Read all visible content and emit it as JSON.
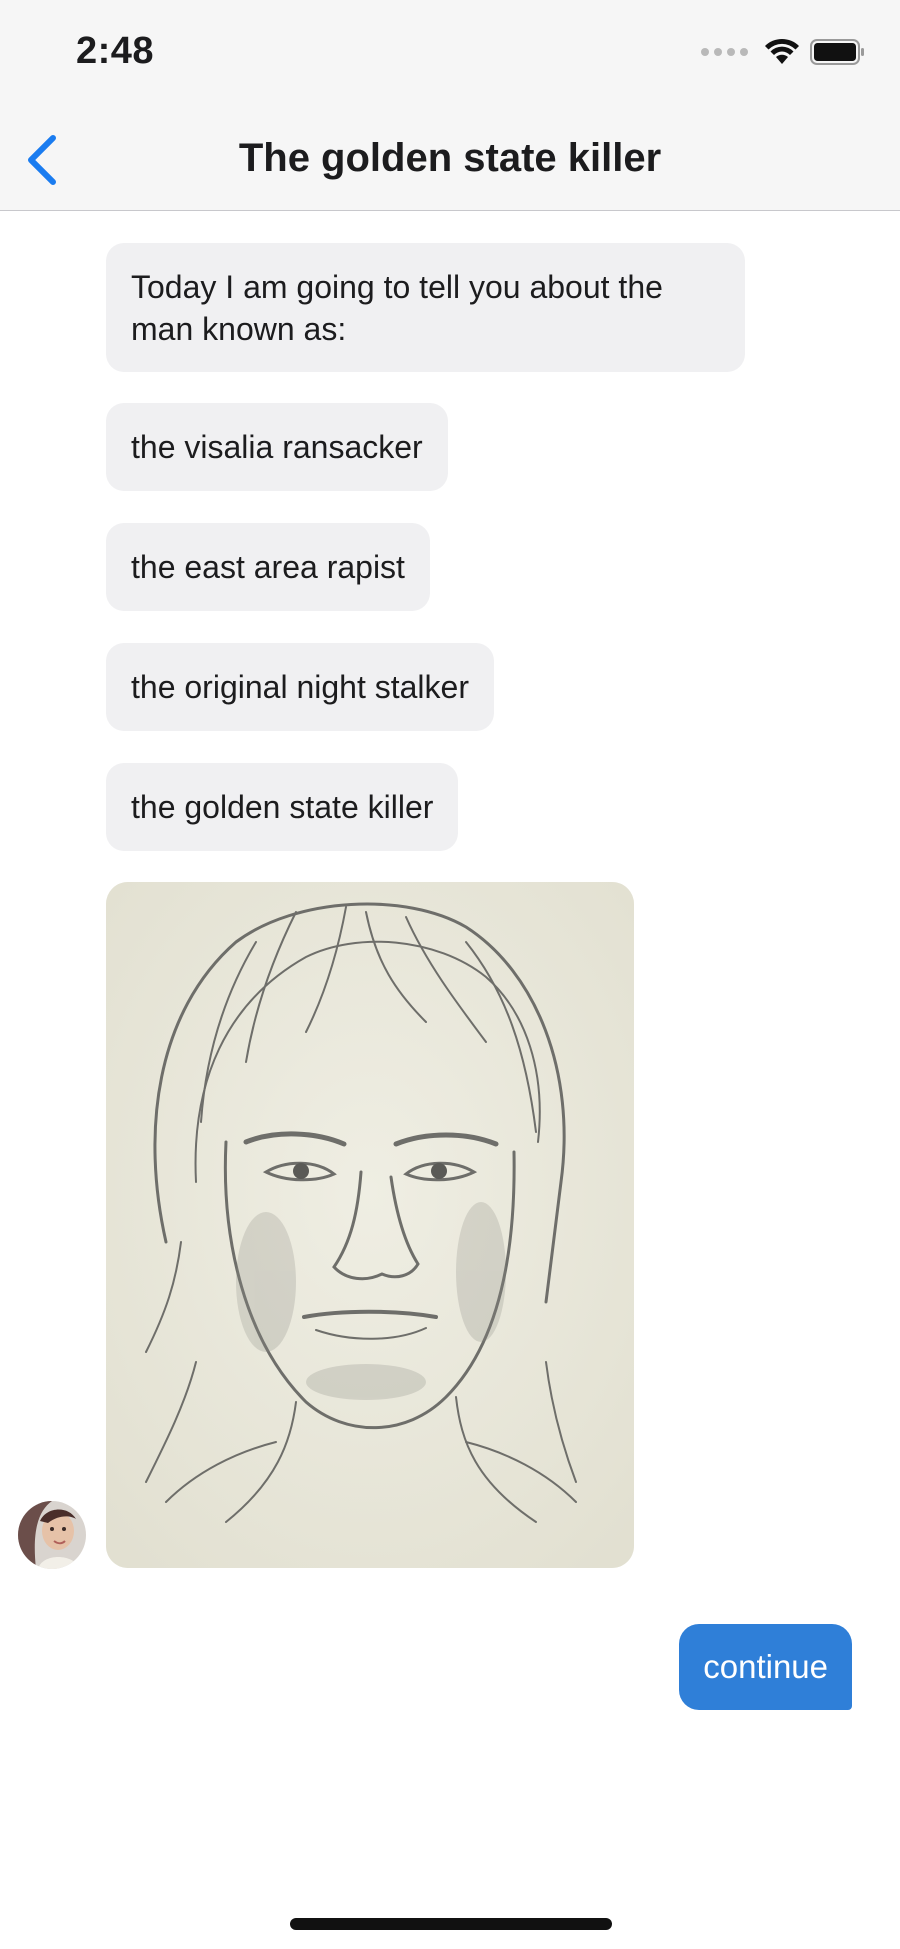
{
  "status_bar": {
    "time": "2:48"
  },
  "nav": {
    "title": "The golden state killer",
    "accent_color": "#1a7cf0"
  },
  "messages": [
    {
      "type": "text",
      "text": "Today I am going to tell you about the man known as:"
    },
    {
      "type": "text",
      "text": "the visalia ransacker"
    },
    {
      "type": "text",
      "text": "the east area rapist"
    },
    {
      "type": "text",
      "text": "the original night stalker"
    },
    {
      "type": "text",
      "text": "the golden state killer"
    },
    {
      "type": "image",
      "depicts": "pencil-sketch-portrait"
    }
  ],
  "reply": {
    "label": "continue",
    "color": "#2f7fd8"
  },
  "colors": {
    "bubble_bg": "#f0f0f2",
    "bar_bg": "#f6f6f6"
  }
}
